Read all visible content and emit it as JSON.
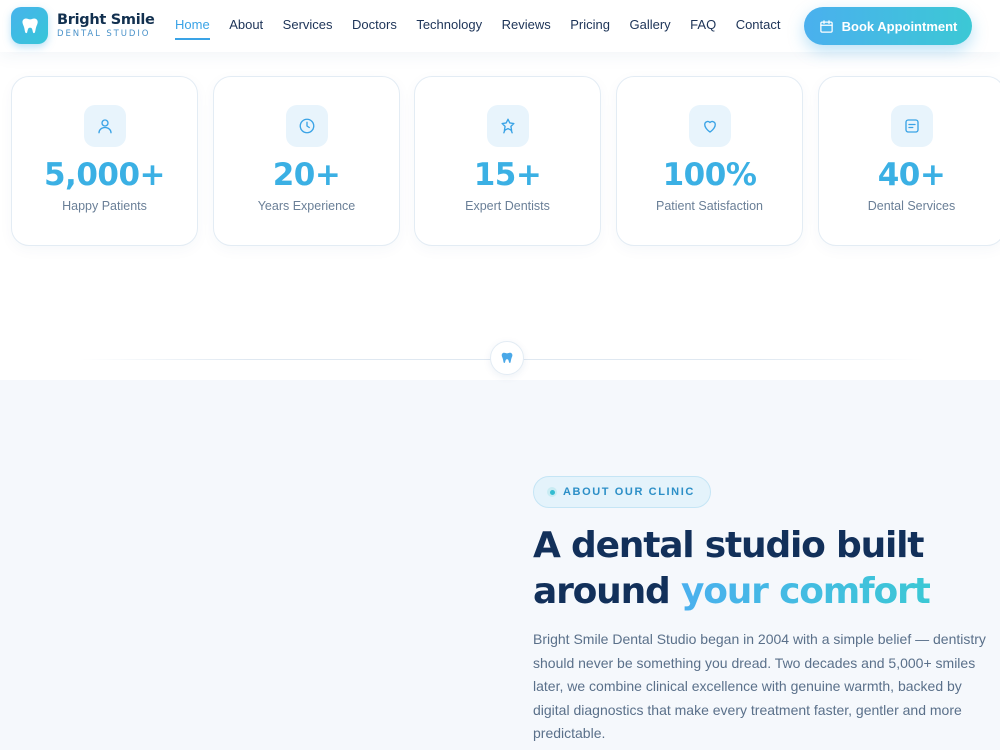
{
  "brand": {
    "name": "Bright Smile",
    "tagline": "DENTAL STUDIO"
  },
  "nav": {
    "items": [
      {
        "label": "Home",
        "active": true
      },
      {
        "label": "About"
      },
      {
        "label": "Services"
      },
      {
        "label": "Doctors"
      },
      {
        "label": "Technology"
      },
      {
        "label": "Reviews"
      },
      {
        "label": "Pricing"
      },
      {
        "label": "Gallery"
      },
      {
        "label": "FAQ"
      },
      {
        "label": "Contact"
      }
    ],
    "cta_label": "Book Appointment",
    "cta_icon": "calendar-icon"
  },
  "stats": [
    {
      "value": "5,000+",
      "label": "Happy Patients",
      "icon": "user-icon"
    },
    {
      "value": "20+",
      "label": "Years Experience",
      "icon": "clock-icon"
    },
    {
      "value": "15+",
      "label": "Expert Dentists",
      "icon": "award-icon"
    },
    {
      "value": "100%",
      "label": "Patient Satisfaction",
      "icon": "heart-icon"
    },
    {
      "value": "40+",
      "label": "Dental Services",
      "icon": "list-icon"
    }
  ],
  "divider": {
    "icon": "tooth-icon"
  },
  "about": {
    "eyebrow": "ABOUT OUR CLINIC",
    "title_line1": "A dental studio built",
    "title_line2_plain": "around ",
    "title_line2_accent": "your comfort",
    "paragraph": "Bright Smile Dental Studio began in 2004 with a simple belief — dentistry should never be something you dread. Two decades and 5,000+ smiles later, we combine clinical excellence with genuine warmth, backed by digital diagnostics that make every treatment faster, gentler and more predictable."
  },
  "colors": {
    "accent": "#3aa3e6",
    "accent_teal": "#3cc8d5",
    "heading": "#12305a",
    "body_text": "#5a708a",
    "section_bg": "#f5f8fc"
  }
}
